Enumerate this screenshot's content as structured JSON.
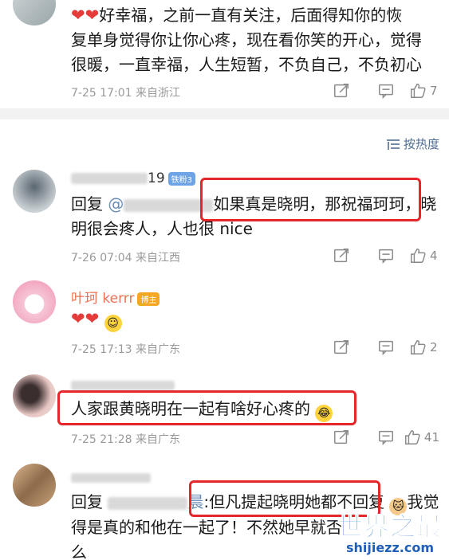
{
  "comment1": {
    "text_line1": "好幸福，之前一直有关注，后面得知你的恢",
    "text_line2": "复单身觉得你让你心疼，现在看你笑的开心，觉得",
    "text_line3": "很暖，一直幸福，人生短暂，不负自己，不负初心",
    "hearts": "❤❤",
    "meta": "7-25 17:01 来自浙江",
    "likes": "7"
  },
  "sort": {
    "label": "按热度"
  },
  "comment2": {
    "name_suffix": "19",
    "badge": "铁粉3",
    "reply_prefix": "回复",
    "mention": "@",
    "text_a": "如果真是晓明，那祝福珂珂，晓",
    "text_b": "明很会疼人，人也很 nice",
    "meta": "7-26 07:04 来自江西",
    "likes": "4"
  },
  "comment3": {
    "name": "叶珂 kerrr",
    "badge": "博主",
    "hearts": "❤❤",
    "meta": "7-25 17:13 来自广东",
    "likes": "2"
  },
  "comment4": {
    "text": "人家跟黄晓明在一起有啥好心疼的",
    "meta": "7-25 21:28 来自广东",
    "likes": "41"
  },
  "comment5": {
    "reply_prefix": "回复",
    "mention_tail": "晨",
    "text_a": ":但凡提起晓明她都不回复",
    "text_b": "我觉",
    "text_c": "得是真的和他在一起了！不然她早就否",
    "text_d": "么"
  },
  "watermark": {
    "title": "世界之最",
    "url": "shijiezz.com"
  },
  "colors": {
    "accent_red": "#e5262a",
    "link_blue": "#506d92",
    "badge_blue": "#6ea3e6",
    "host_orange": "#f5a623"
  }
}
